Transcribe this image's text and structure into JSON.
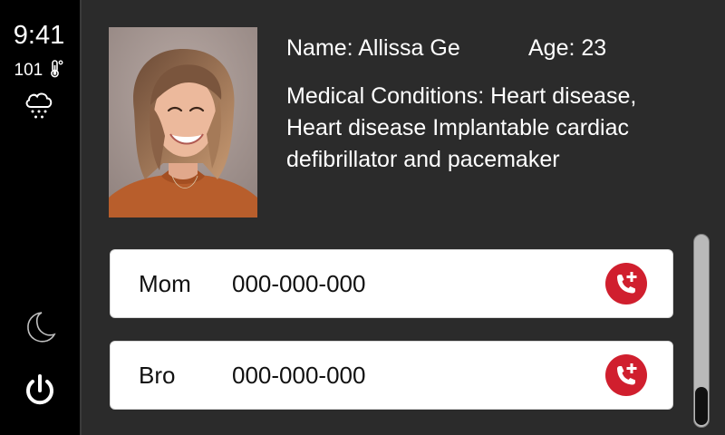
{
  "sidebar": {
    "time": "9:41",
    "temperature": "101",
    "thermometer_icon": "thermometer-icon",
    "weather_icon": "cloud-snow-icon",
    "night_mode_icon": "moon-icon",
    "power_icon": "power-icon"
  },
  "profile": {
    "photo": "profile-photo",
    "name": "Name: Allissa Ge",
    "age": "Age: 23",
    "medical_conditions": "Medical Conditions: Heart disease, Heart disease Implantable cardiac defibrillator and pacemaker"
  },
  "contacts": [
    {
      "name": "Mom",
      "phone": "000-000-000",
      "call_icon": "emergency-call-icon"
    },
    {
      "name": "Bro",
      "phone": "000-000-000",
      "call_icon": "emergency-call-icon"
    }
  ],
  "colors": {
    "background": "#2b2b2b",
    "sidebar": "#000000",
    "card": "#ffffff",
    "call_accent": "#d01f2e"
  }
}
